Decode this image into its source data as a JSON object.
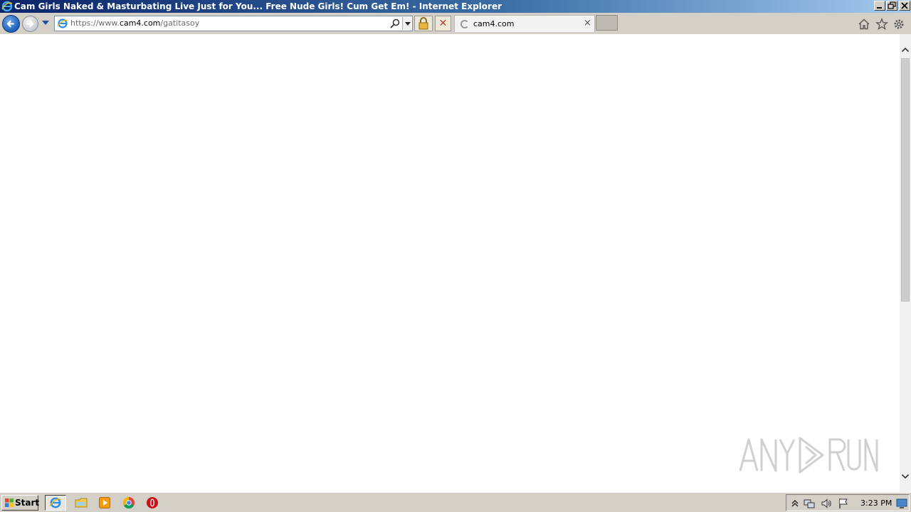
{
  "window": {
    "title": "Cam Girls Naked & Masturbating Live Just for You... Free Nude Girls! Cum Get Em! - Internet Explorer",
    "minimize_label": "0",
    "maximize_label": "1",
    "close_label": "r"
  },
  "address": {
    "scheme": "https://www.",
    "domain": "cam4.com",
    "path": "/gatitasoy"
  },
  "tab": {
    "label": "cam4.com",
    "close_glyph": "×"
  },
  "stop_glyph": "✕",
  "watermark": {
    "text": "ANY RUN"
  },
  "taskbar": {
    "start_label": "Start",
    "clock": "3:23 PM"
  },
  "icons": {
    "page": "ie-page-icon",
    "search": "search-icon",
    "lock": "lock-icon",
    "home": "home-icon",
    "favorites": "star-icon",
    "tools": "gear-icon"
  },
  "colors": {
    "titlebar_start": "#0a246a",
    "titlebar_end": "#a6caf0",
    "chrome_bg": "#d4d0c8",
    "back_button": "#1d5fb8"
  }
}
